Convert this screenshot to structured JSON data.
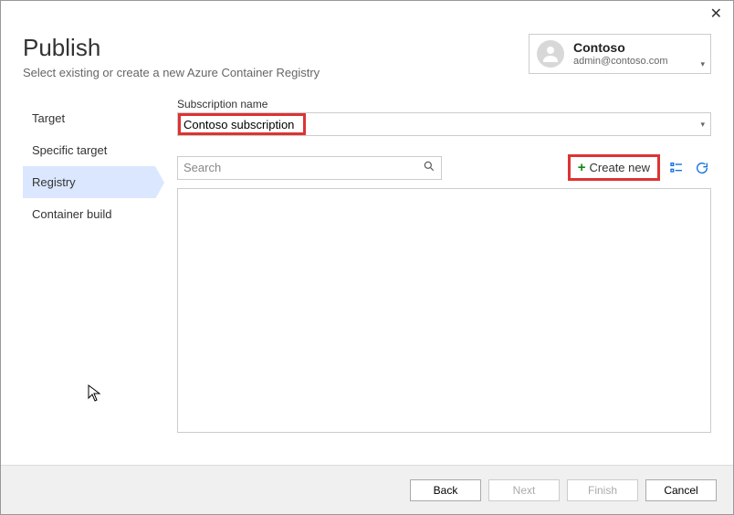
{
  "close_label": "✕",
  "header": {
    "title": "Publish",
    "subtitle": "Select existing or create a new Azure Container Registry"
  },
  "account": {
    "name": "Contoso",
    "email": "admin@contoso.com"
  },
  "sidebar": {
    "items": [
      {
        "label": "Target"
      },
      {
        "label": "Specific target"
      },
      {
        "label": "Registry",
        "active": true
      },
      {
        "label": "Container build"
      }
    ]
  },
  "form": {
    "subscription_label": "Subscription name",
    "subscription_value": "Contoso subscription",
    "search_placeholder": "Search",
    "create_new_label": "Create new"
  },
  "footer": {
    "back": "Back",
    "next": "Next",
    "finish": "Finish",
    "cancel": "Cancel"
  }
}
